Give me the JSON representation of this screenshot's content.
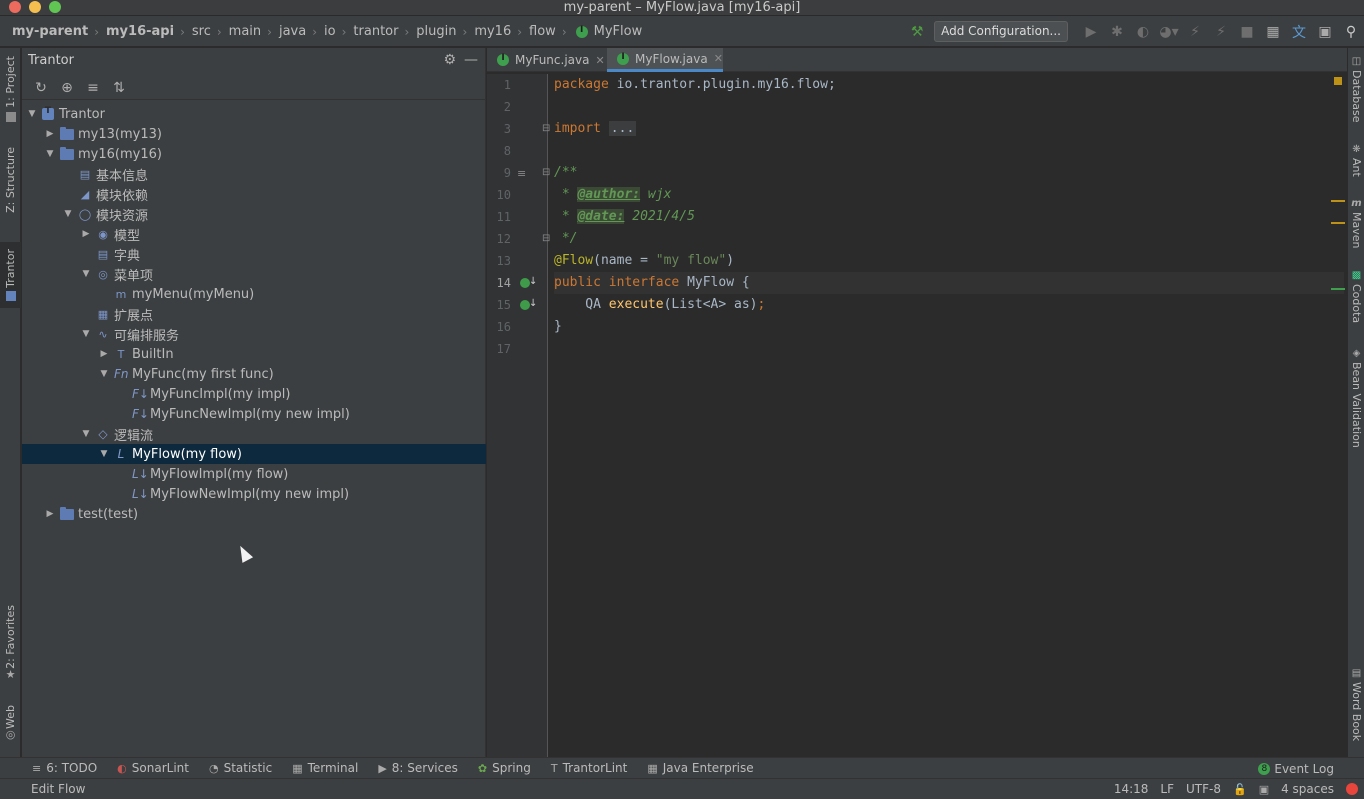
{
  "window": {
    "title": "my-parent – MyFlow.java [my16-api]"
  },
  "breadcrumbs": [
    "my-parent",
    "my16-api",
    "src",
    "main",
    "java",
    "io",
    "trantor",
    "plugin",
    "my16",
    "flow",
    "MyFlow"
  ],
  "toolbar": {
    "config_label": "Add Configuration..."
  },
  "left_tabs": {
    "project": "1: Project",
    "structure": "Z: Structure",
    "trantor": "Trantor",
    "favorites": "2: Favorites",
    "web": "Web"
  },
  "panel": {
    "title": "Trantor",
    "tree": [
      {
        "label": "Trantor",
        "indent": 0,
        "expanded": true,
        "icon": "trantor-icon"
      },
      {
        "label": "my13(my13)",
        "indent": 1,
        "expanded": false,
        "icon": "folder-icon"
      },
      {
        "label": "my16(my16)",
        "indent": 1,
        "expanded": true,
        "icon": "folder-icon"
      },
      {
        "label": "基本信息",
        "indent": 2,
        "expanded": null,
        "icon": "info-icon"
      },
      {
        "label": "模块依赖",
        "indent": 2,
        "expanded": null,
        "icon": "dependency-icon"
      },
      {
        "label": "模块资源",
        "indent": 2,
        "expanded": true,
        "icon": "globe-icon"
      },
      {
        "label": "模型",
        "indent": 3,
        "expanded": false,
        "icon": "model-icon"
      },
      {
        "label": "字典",
        "indent": 3,
        "expanded": null,
        "icon": "dictionary-icon"
      },
      {
        "label": "菜单项",
        "indent": 3,
        "expanded": true,
        "icon": "menu-icon"
      },
      {
        "label": "myMenu(myMenu)",
        "indent": 4,
        "expanded": null,
        "icon": "menu-item-icon"
      },
      {
        "label": "扩展点",
        "indent": 3,
        "expanded": null,
        "icon": "extension-icon"
      },
      {
        "label": "可编排服务",
        "indent": 3,
        "expanded": true,
        "icon": "service-icon"
      },
      {
        "label": "BuiltIn",
        "indent": 4,
        "expanded": false,
        "icon": "builtin-icon"
      },
      {
        "label": "MyFunc(my first func)",
        "indent": 4,
        "expanded": true,
        "icon": "func-icon"
      },
      {
        "label": "MyFuncImpl(my impl)",
        "indent": 5,
        "expanded": null,
        "icon": "func-impl-icon"
      },
      {
        "label": "MyFuncNewImpl(my new impl)",
        "indent": 5,
        "expanded": null,
        "icon": "func-impl-icon"
      },
      {
        "label": "逻辑流",
        "indent": 3,
        "expanded": true,
        "icon": "flow-icon"
      },
      {
        "label": "MyFlow(my flow)",
        "indent": 4,
        "expanded": true,
        "icon": "flow-item-icon",
        "selected": true
      },
      {
        "label": "MyFlowImpl(my flow)",
        "indent": 5,
        "expanded": null,
        "icon": "flow-impl-icon"
      },
      {
        "label": "MyFlowNewImpl(my new impl)",
        "indent": 5,
        "expanded": null,
        "icon": "flow-impl-icon"
      },
      {
        "label": "test(test)",
        "indent": 1,
        "expanded": false,
        "icon": "folder-icon"
      }
    ]
  },
  "tabs": [
    {
      "label": "MyFunc.java",
      "active": false
    },
    {
      "label": "MyFlow.java",
      "active": true
    }
  ],
  "editor": {
    "line_numbers": [
      "1",
      "2",
      "3",
      "8",
      "9",
      "10",
      "11",
      "12",
      "13",
      "14",
      "15",
      "16",
      "17"
    ],
    "current_line": "14",
    "code": {
      "l1_kw": "package",
      "l1_rest": " io.trantor.plugin.my16.flow;",
      "l3_kw": "import",
      "l3_fold": "...",
      "l9": "/**",
      "l10_star": " * ",
      "l10_tag": "@author:",
      "l10_val": " wjx",
      "l11_star": " * ",
      "l11_tag": "@date:",
      "l11_val": " 2021/4/5",
      "l12": " */",
      "l13_ann": "@Flow",
      "l13_open": "(name = ",
      "l13_str": "\"my flow\"",
      "l13_close": ")",
      "l14_kw1": "public",
      "l14_kw2": "interface",
      "l14_name": "MyFlow",
      "l14_rest": " {",
      "l15_type": "    QA ",
      "l15_fn": "execute",
      "l15_rest": "(List<A> as)",
      "l15_semi": ";",
      "l16": "}"
    }
  },
  "right_tabs": {
    "database": "Database",
    "ant": "Ant",
    "maven": "Maven",
    "codota": "Codota",
    "bean": "Bean Validation",
    "wordbook": "Word Book"
  },
  "bottom_tools": [
    {
      "label": "6: TODO",
      "icon": "list-icon"
    },
    {
      "label": "SonarLint",
      "icon": "sonarlint-icon"
    },
    {
      "label": "Statistic",
      "icon": "statistic-icon"
    },
    {
      "label": "Terminal",
      "icon": "terminal-icon"
    },
    {
      "label": "8: Services",
      "icon": "services-icon"
    },
    {
      "label": "Spring",
      "icon": "spring-icon"
    },
    {
      "label": "TrantorLint",
      "icon": "trantorlint-icon"
    },
    {
      "label": "Java Enterprise",
      "icon": "java-enterprise-icon"
    }
  ],
  "event_log": {
    "count": "8",
    "label": "Event Log"
  },
  "status": {
    "message": "Edit Flow",
    "position": "14:18",
    "line_sep": "LF",
    "encoding": "UTF-8",
    "indent": "4 spaces"
  }
}
